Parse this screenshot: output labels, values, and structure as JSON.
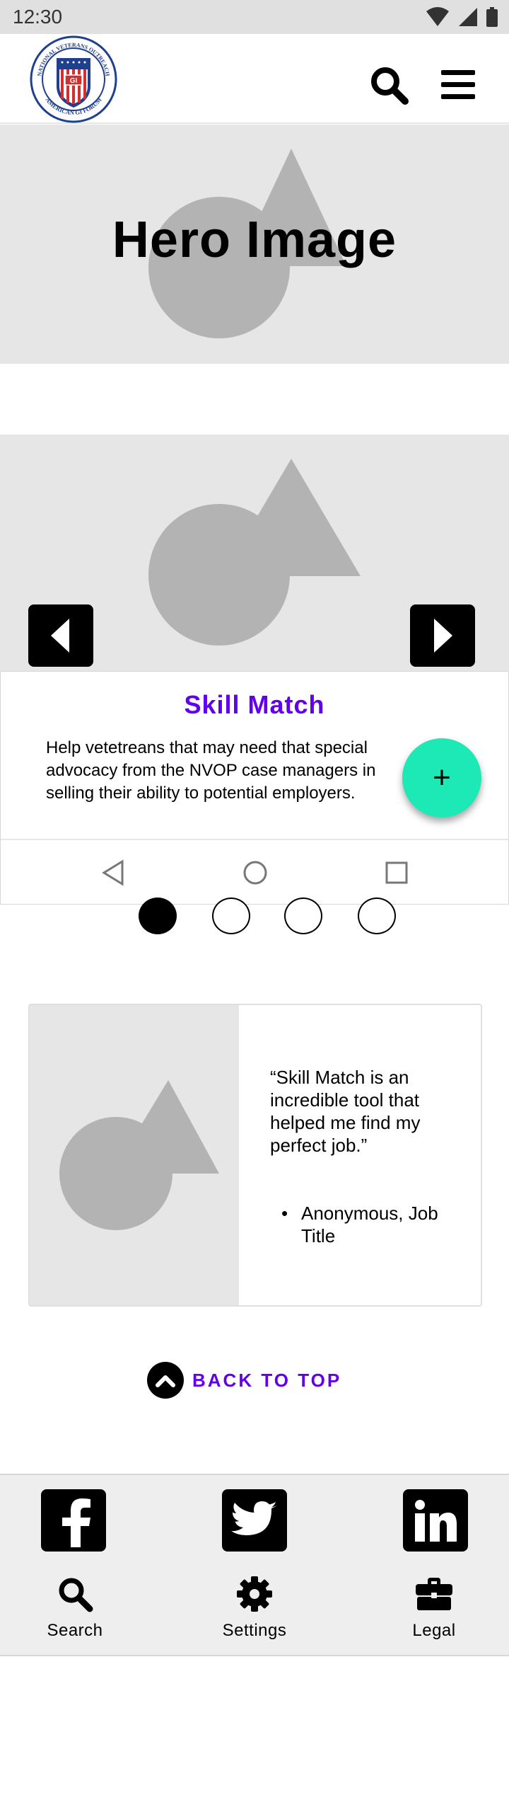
{
  "status_bar": {
    "time": "12:30"
  },
  "header": {
    "logo_text": {
      "top": "NATIONAL VETERANS OUTREACH",
      "bottom": "AMERICAN GI FORUM",
      "center": "GI"
    }
  },
  "hero": {
    "title": "Hero Image"
  },
  "carousel": {
    "slide_count": 4,
    "active_index": 0
  },
  "card": {
    "title": "Skill Match",
    "body": "Help vetetreans that may need that special advocacy from the NVOP case managers in selling their ability to potential employers.",
    "fab_label": "+"
  },
  "testimonial": {
    "quote": "“Skill Match is an incredible tool that helped me find my perfect job.”",
    "bullet": "•",
    "attribution": "Anonymous, Job Title"
  },
  "back_to_top": {
    "label": "BACK TO TOP"
  },
  "footer": {
    "nav": [
      {
        "label": "Search"
      },
      {
        "label": "Settings"
      },
      {
        "label": "Legal"
      }
    ]
  },
  "colors": {
    "accent": "#6200ee",
    "fab": "#1de9b6",
    "placeholder": "#e6e6e6",
    "shape": "#b3b3b3"
  }
}
